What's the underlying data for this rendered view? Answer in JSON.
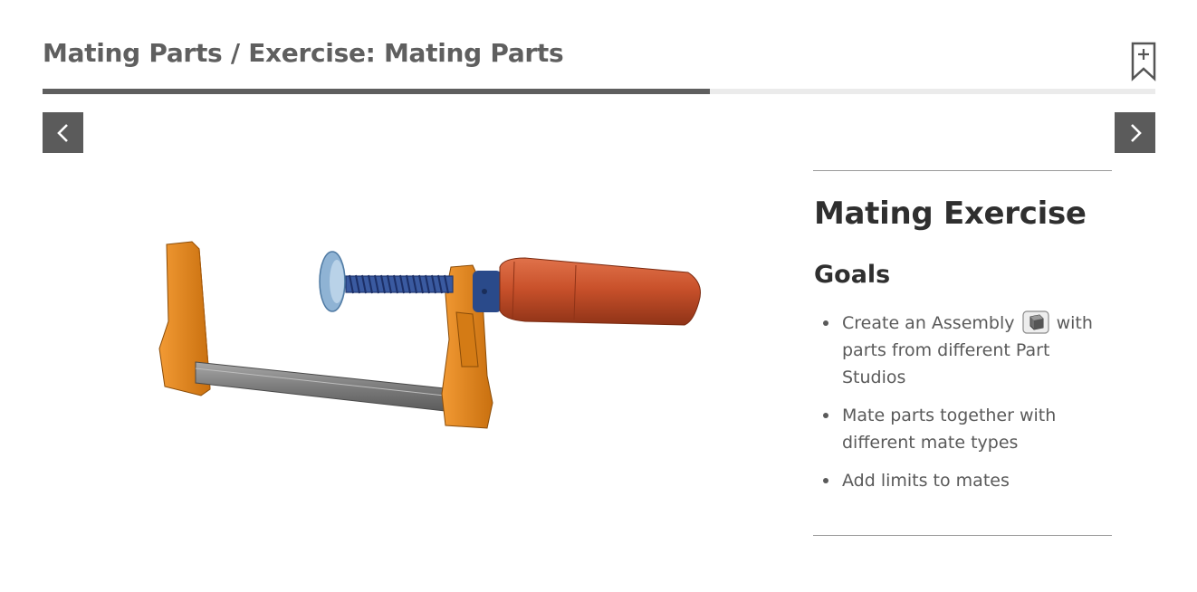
{
  "header": {
    "breadcrumb": "Mating Parts / Exercise: Mating Parts",
    "bookmark_icon": "bookmark-add-icon"
  },
  "progress": {
    "fraction": 0.6
  },
  "navigation": {
    "prev_icon": "chevron-left-icon",
    "next_icon": "chevron-right-icon"
  },
  "illustration": {
    "subject": "bar-clamp"
  },
  "panel": {
    "title": "Mating Exercise",
    "subtitle": "Goals",
    "goals": [
      {
        "before": "Create an Assembly",
        "icon": "assembly-icon",
        "after": "with parts from different Part Studios"
      },
      {
        "text": "Mate parts together with different mate types"
      },
      {
        "text": "Add limits to mates"
      }
    ]
  },
  "colors": {
    "accent": "#5f5f5f",
    "nav_button": "#5b5b5b",
    "track": "#ebebeb",
    "clamp_orange": "#e88a1e",
    "handle_red": "#c9512b",
    "screw_blue": "#2f4f8f",
    "bar_gray": "#8a8a8a"
  }
}
